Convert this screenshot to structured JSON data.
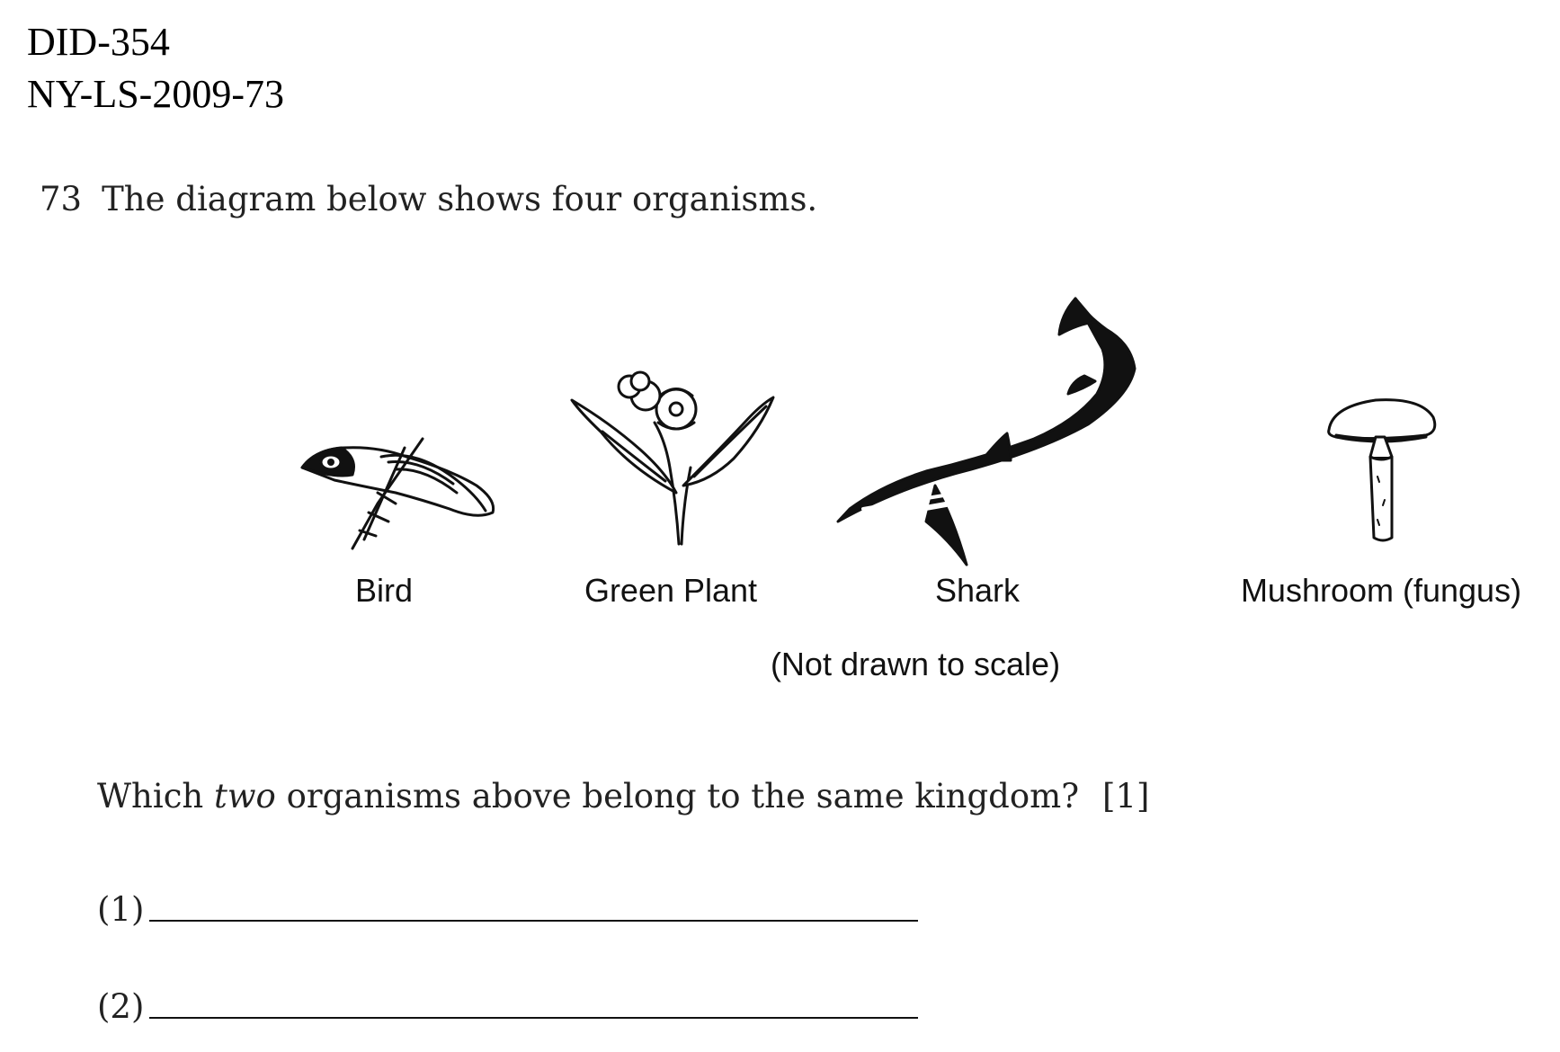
{
  "header": {
    "id_line_1": "DID-354",
    "id_line_2": "NY-LS-2009-73"
  },
  "question": {
    "number": "73",
    "stem": "The diagram below shows four organisms.",
    "prompt_before": "Which ",
    "prompt_emphasis": "two",
    "prompt_after": " organisms above belong to the same kingdom?",
    "points": "[1]"
  },
  "figure": {
    "organisms": [
      {
        "label": "Bird",
        "icon": "bird-icon"
      },
      {
        "label": "Green Plant",
        "icon": "flower-icon"
      },
      {
        "label": "Shark",
        "icon": "shark-icon"
      },
      {
        "label": "Mushroom (fungus)",
        "icon": "mushroom-icon"
      }
    ],
    "note": "(Not drawn to scale)"
  },
  "answers": [
    {
      "number": "(1)"
    },
    {
      "number": "(2)"
    }
  ]
}
